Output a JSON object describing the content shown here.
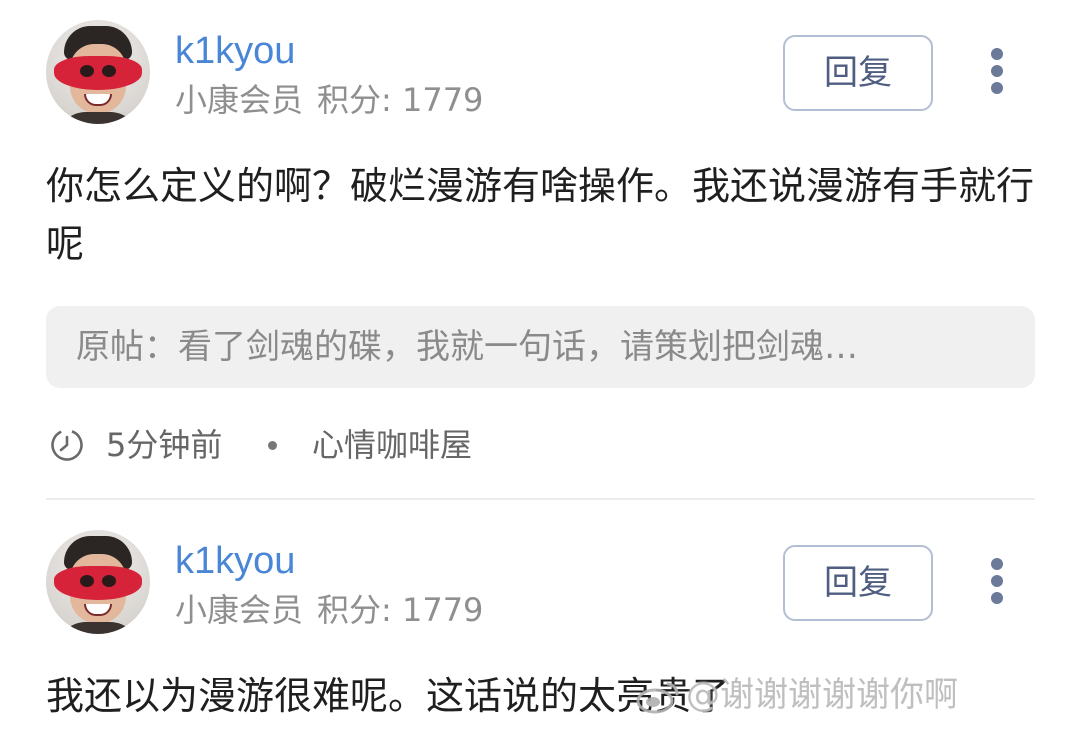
{
  "posts": [
    {
      "username": "k1kyou",
      "member_level": "小康会员",
      "score_label": "积分: 1779",
      "reply_label": "回复",
      "content": "你怎么定义的啊？破烂漫游有啥操作。我还说漫游有手就行呢",
      "quote": "原帖：看了剑魂的碟，我就一句话，请策划把剑魂…",
      "time": "5分钟前",
      "board": "心情咖啡屋"
    },
    {
      "username": "k1kyou",
      "member_level": "小康会员",
      "score_label": "积分: 1779",
      "reply_label": "回复",
      "content": "我还以为漫游很难呢。这话说的太亮贵了"
    }
  ],
  "watermark": {
    "text": "@谢谢谢谢谢你啊"
  },
  "icons": {
    "clock": "clock-icon",
    "more": "more-vertical-icon",
    "watermark_logo": "weibo-logo-icon"
  },
  "colors": {
    "username": "#4a86d6",
    "meta_gray": "#8f8f8f",
    "quote_bg": "#f0f0f1",
    "button_border": "#b3bed4",
    "button_text": "#4e5d80"
  }
}
